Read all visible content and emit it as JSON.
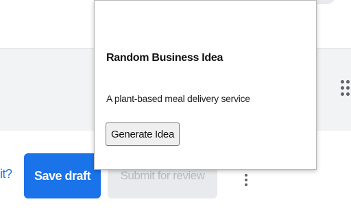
{
  "page": {
    "question_fragment": "it?",
    "actions": {
      "save_draft_label": "Save draft",
      "submit_label": "Submit for review"
    },
    "colors": {
      "primary": "#1a73e8",
      "disabled_bg": "#e8eaed",
      "band_bg": "#f1f3f4"
    },
    "icons": {
      "drag_handle": "drag-handle-icon",
      "more": "more-vert-icon"
    }
  },
  "popup": {
    "title": "Random Business Idea",
    "idea_text": "A plant-based meal delivery service",
    "generate_label": "Generate Idea"
  }
}
